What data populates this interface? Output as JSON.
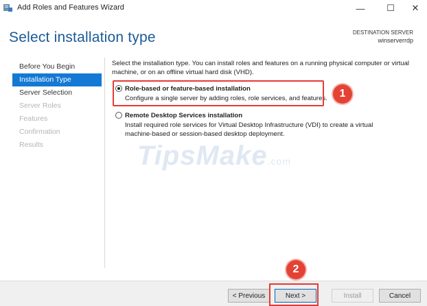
{
  "window": {
    "title": "Add Roles and Features Wizard",
    "minimize_glyph": "—",
    "maximize_glyph": "☐",
    "close_glyph": "✕"
  },
  "header": {
    "title": "Select installation type",
    "destination_label": "DESTINATION SERVER",
    "destination_server": "winserverrdp"
  },
  "nav": {
    "items": [
      {
        "label": "Before You Begin",
        "state": "normal"
      },
      {
        "label": "Installation Type",
        "state": "active"
      },
      {
        "label": "Server Selection",
        "state": "normal"
      },
      {
        "label": "Server Roles",
        "state": "disabled"
      },
      {
        "label": "Features",
        "state": "disabled"
      },
      {
        "label": "Confirmation",
        "state": "disabled"
      },
      {
        "label": "Results",
        "state": "disabled"
      }
    ]
  },
  "main": {
    "intro": "Select the installation type. You can install roles and features on a running physical computer or virtual machine, or on an offline virtual hard disk (VHD).",
    "options": [
      {
        "title": "Role-based or feature-based installation",
        "description": "Configure a single server by adding roles, role services, and features.",
        "selected": true
      },
      {
        "title": "Remote Desktop Services installation",
        "description": "Install required role services for Virtual Desktop Infrastructure (VDI) to create a virtual machine-based or session-based desktop deployment.",
        "selected": false
      }
    ]
  },
  "annotations": {
    "step1": "1",
    "step2": "2",
    "highlight_color": "#e53935"
  },
  "watermark": {
    "text": "TipsMake",
    "suffix": ".com"
  },
  "footer": {
    "previous": "< Previous",
    "next": "Next >",
    "install": "Install",
    "cancel": "Cancel"
  },
  "colors": {
    "accent": "#1479d4",
    "title_blue": "#1a5a96"
  }
}
